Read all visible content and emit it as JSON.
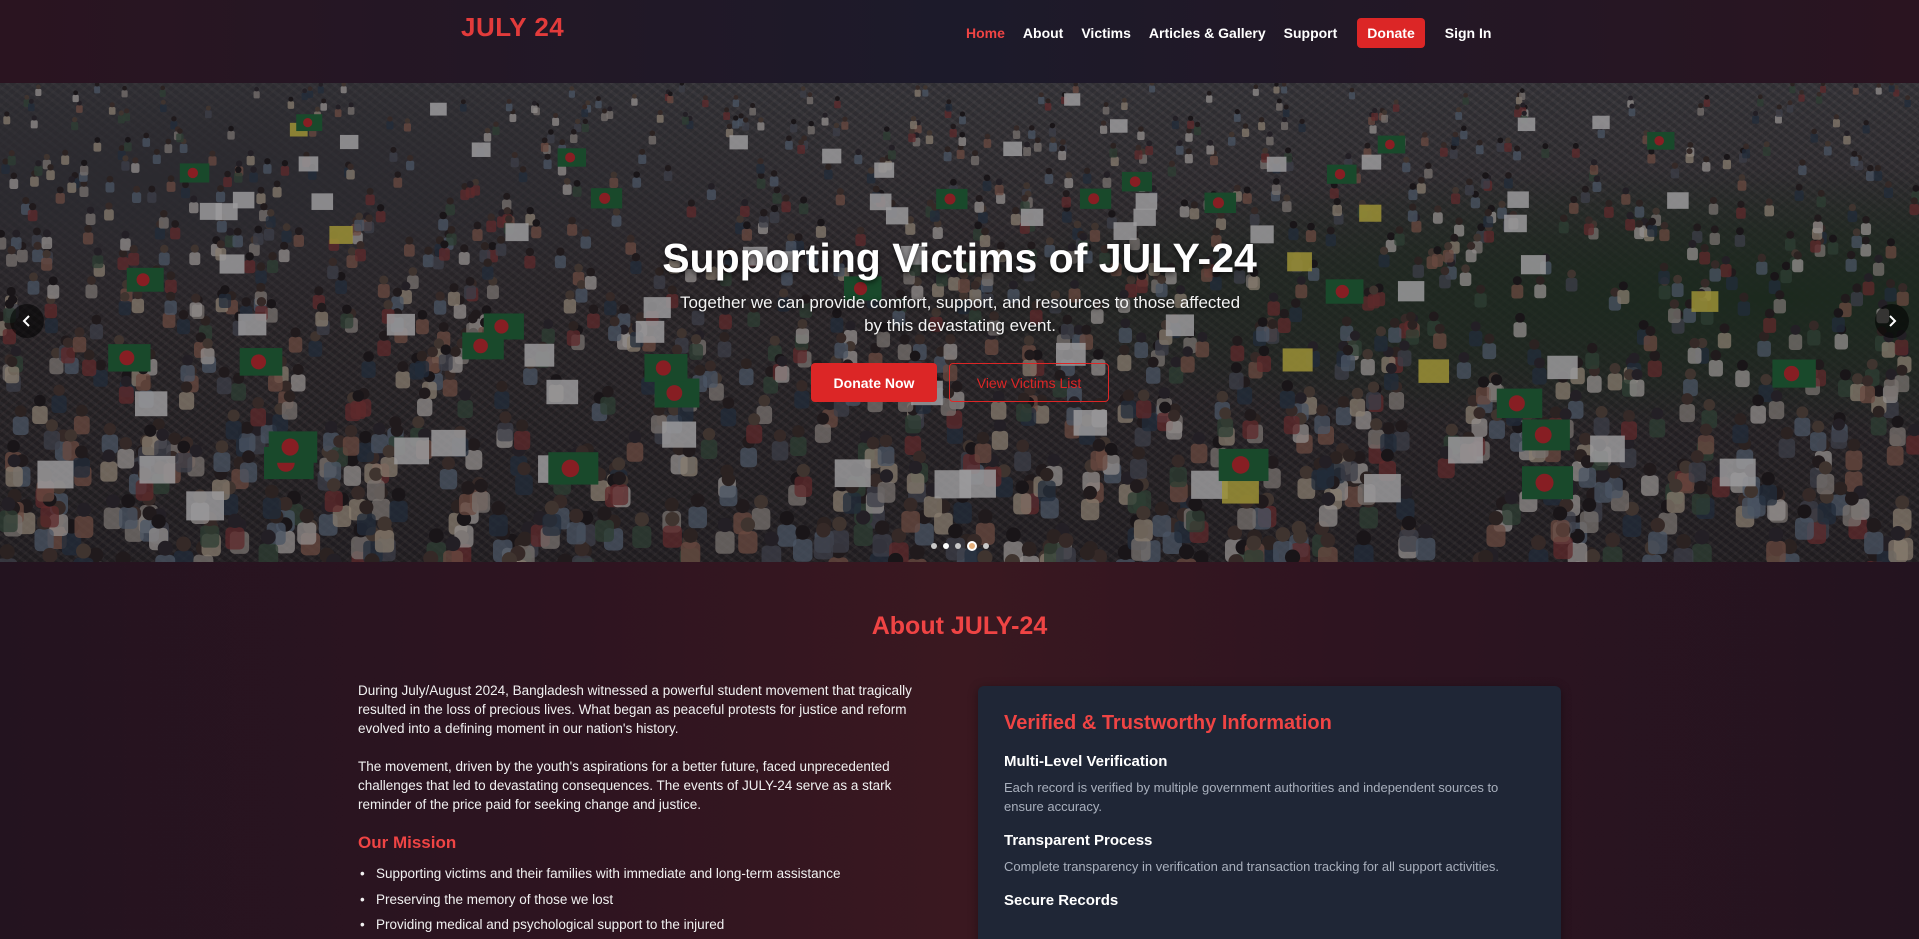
{
  "navbar": {
    "brand": "JULY 24",
    "links": [
      "Home",
      "About",
      "Victims",
      "Articles & Gallery",
      "Support"
    ],
    "donate_label": "Donate",
    "signin_label": "Sign In",
    "active": "Home"
  },
  "hero": {
    "title": "Supporting Victims of JULY-24",
    "subtitle": "Together we can provide comfort, support, and resources to those affected by this devastating event.",
    "donate_now_label": "Donate Now",
    "view_victims_label": "View Victims List",
    "prev_icon": "chevron-left-icon",
    "next_icon": "chevron-right-icon",
    "slides_count": 5,
    "active_slide": 4
  },
  "about": {
    "title": "About JULY-24",
    "paragraphs": [
      "During July/August 2024, Bangladesh witnessed a powerful student movement that tragically resulted in the loss of precious lives. What began as peaceful protests for justice and reform evolved into a defining moment in our nation's history.",
      "The movement, driven by the youth's aspirations for a better future, faced unprecedented challenges that led to devastating consequences. The events of JULY-24 serve as a stark reminder of the price paid for seeking change and justice."
    ],
    "mission_title": "Our Mission",
    "mission_items": [
      "Supporting victims and their families with immediate and long-term assistance",
      "Preserving the memory of those we lost",
      "Providing medical and psychological support to the injured"
    ]
  },
  "verify": {
    "title": "Verified & Trustworthy Information",
    "items": [
      {
        "title": "Multi-Level Verification",
        "text": "Each record is verified by multiple government authorities and independent sources to ensure accuracy."
      },
      {
        "title": "Transparent Process",
        "text": "Complete transparency in verification and transaction tracking for all support activities."
      },
      {
        "title": "Secure Records",
        "text": ""
      }
    ]
  },
  "colors": {
    "accent": "#ef4444",
    "button": "#dc2626",
    "card": "#1f2636"
  }
}
